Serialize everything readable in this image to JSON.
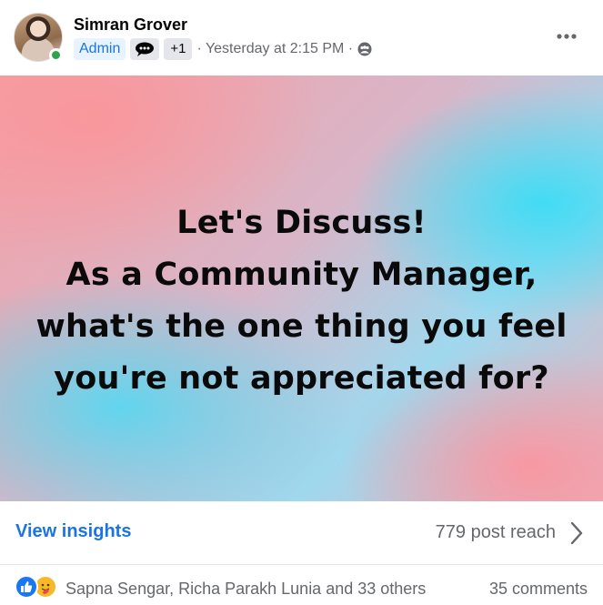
{
  "post": {
    "author": "Simran Grover",
    "badges": {
      "role": "Admin",
      "extra": "+1"
    },
    "timestamp": "· Yesterday at 2:15 PM ·",
    "audience_icon": "group-icon",
    "more_icon": "more-horizontal-icon",
    "text_lines": [
      "Let's Discuss!",
      "As a Community Manager,",
      "what's the one thing you feel",
      "you're not appreciated for?"
    ],
    "background_colors": [
      "#f4a0a6",
      "#3cdcf5",
      "#fa969b"
    ]
  },
  "insights": {
    "link_label": "View insights",
    "reach": "779 post reach"
  },
  "engagement": {
    "reactions": [
      "like-icon",
      "care-icon"
    ],
    "reactors": "Sapna Sengar, Richa Parakh Lunia and 33 others",
    "comments": "35 comments"
  },
  "colors": {
    "accent": "#1b74e4",
    "secondary_text": "#65676b",
    "online": "#31a24c"
  }
}
